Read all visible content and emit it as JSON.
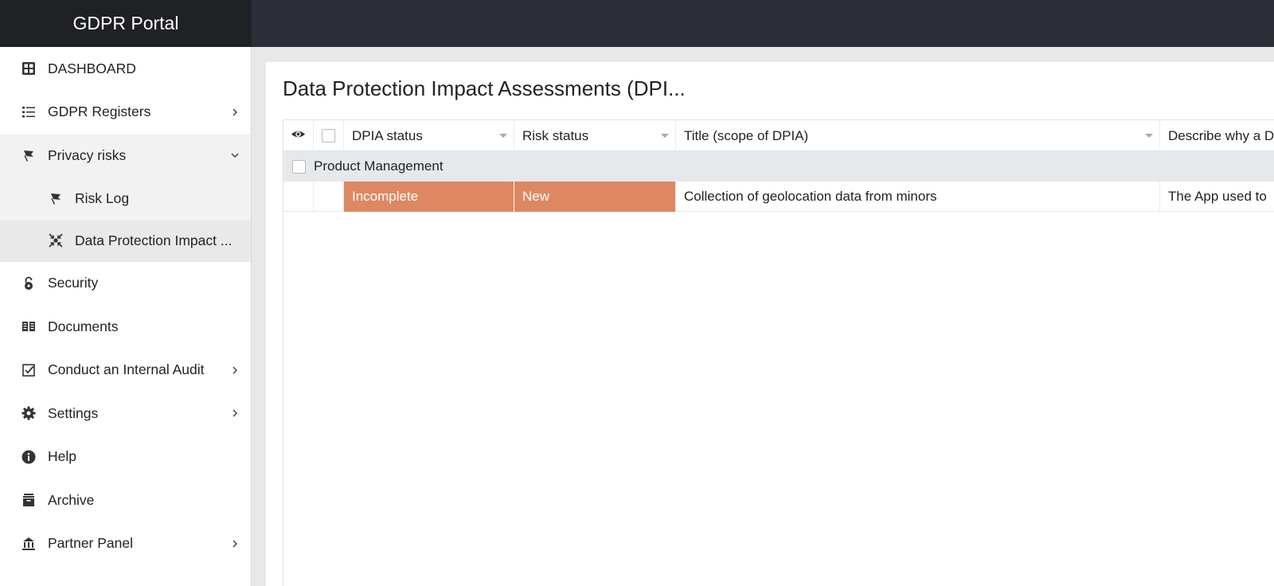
{
  "app": {
    "title": "GDPR Portal"
  },
  "colors": {
    "status_fill": "#dd8863",
    "topbar": "#2b2e36",
    "brand_bg": "#1f2124"
  },
  "sidebar": {
    "items": [
      {
        "label": "DASHBOARD",
        "icon": "dashboard-grid-icon"
      },
      {
        "label": "GDPR Registers",
        "icon": "list-icon",
        "chevron": "right"
      },
      {
        "label": "Privacy risks",
        "icon": "flag-icon",
        "chevron": "down"
      },
      {
        "label": "Risk Log",
        "icon": "flag-icon"
      },
      {
        "label": "Data Protection Impact ...",
        "icon": "impact-arrows-icon"
      },
      {
        "label": "Security",
        "icon": "lock-icon"
      },
      {
        "label": "Documents",
        "icon": "documents-icon"
      },
      {
        "label": "Conduct an Internal Audit",
        "icon": "checkbox-icon",
        "chevron": "right"
      },
      {
        "label": "Settings",
        "icon": "gear-icon",
        "chevron": "right"
      },
      {
        "label": "Help",
        "icon": "info-icon"
      },
      {
        "label": "Archive",
        "icon": "archive-icon"
      },
      {
        "label": "Partner Panel",
        "icon": "partner-icon",
        "chevron": "right"
      }
    ]
  },
  "main": {
    "title": "Data Protection Impact Assessments (DPI...",
    "table": {
      "columns": [
        "DPIA status",
        "Risk status",
        "Title (scope of DPIA)",
        "Describe why a D"
      ],
      "group": "Product Management",
      "rows": [
        {
          "dpia_status": "Incomplete",
          "risk_status": "New",
          "title": "Collection of geolocation data from minors",
          "describe": "The App used to"
        }
      ]
    }
  }
}
